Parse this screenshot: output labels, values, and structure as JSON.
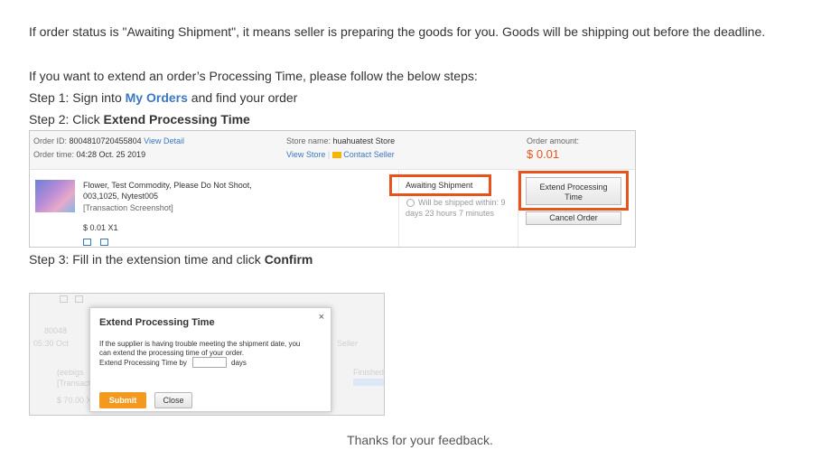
{
  "intro": "If order status is \"Awaiting Shipment\", it means seller is preparing the goods for you. Goods will be shipping out before the deadline.",
  "extend_intro": "If you want to extend an order’s Processing Time, please follow the below steps:",
  "step1": {
    "prefix": "Step 1: Sign into ",
    "link": "My Orders",
    "suffix": " and find your order"
  },
  "step2": {
    "prefix": "Step 2: Click ",
    "bold": "Extend Processing Time"
  },
  "step3": {
    "prefix": "Step 3: Fill in the extension time and click ",
    "bold": "Confirm"
  },
  "shot1": {
    "order_id_label": "Order ID: ",
    "order_id": "8004810720455804",
    "view_detail": "View Detail",
    "order_time_label": "Order time: ",
    "order_time": "04:28 Oct. 25 2019",
    "store_label": "Store name: ",
    "store_name": "huahuatest Store",
    "view_store": "View Store",
    "contact_seller": "Contact Seller",
    "amount_label": "Order amount:",
    "amount": "$ 0.01",
    "product_line1": "Flower, Test Commodity, Please Do Not Shoot,",
    "product_line2": "003,1025, Nytest005",
    "product_line3": "[Transaction Screenshot]",
    "price": "$ 0.01 X1",
    "status": "Awaiting Shipment",
    "ship_line1": "Will be shipped within: 9",
    "ship_line2": "days 23 hours 7 minutes",
    "extend_button_line1": "Extend Processing",
    "extend_button_line2": "Time",
    "cancel_button": "Cancel Order"
  },
  "shot2": {
    "dialog_title": "Extend Processing Time",
    "close_symbol": "×",
    "line1": "If the supplier is having trouble meeting the shipment date, you",
    "line2": "can extend the processing time of your order.",
    "line3_prefix": "Extend Processing Time by",
    "days": "days",
    "submit": "Submit",
    "close": "Close",
    "bg_order": "80048",
    "bg_date": "05:30 Oct",
    "bg_item": "(eebigs",
    "bg_trans": "[Transact",
    "bg_price": "$ 70.00 X",
    "bg_finished": "Finished",
    "bg_seller": "Seller"
  },
  "thanks": "Thanks for your feedback."
}
